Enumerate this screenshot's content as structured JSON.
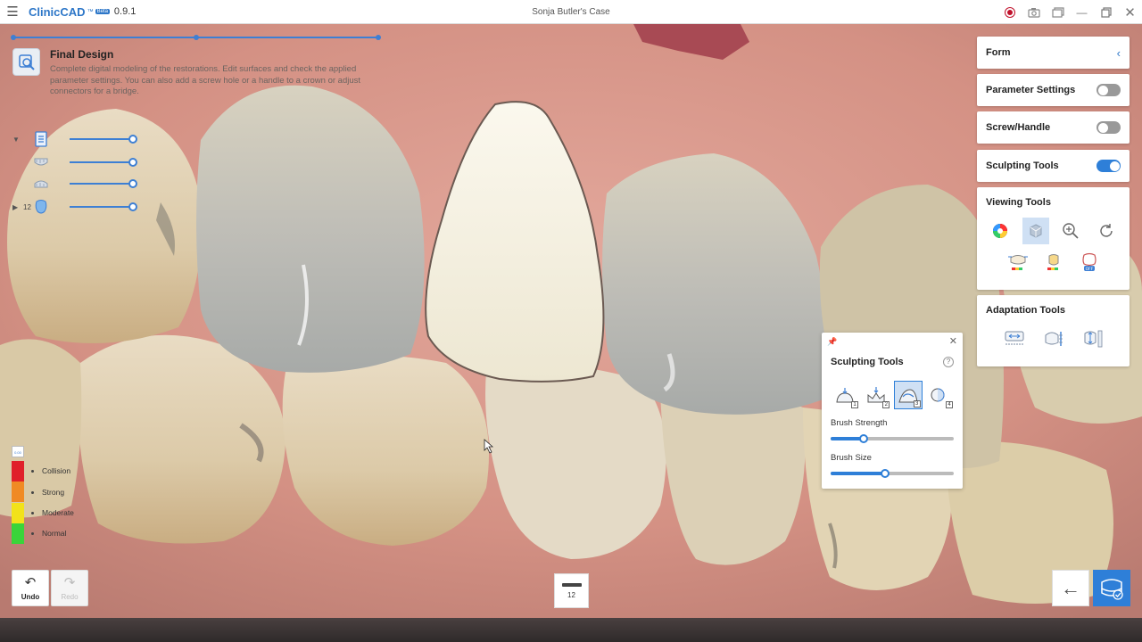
{
  "titlebar": {
    "brand": "ClinicCAD",
    "brand_sup": "™",
    "beta": "Beta",
    "version": "0.9.1",
    "case_name": "Sonja Butler's Case"
  },
  "step": {
    "title": "Final Design",
    "description": "Complete digital modeling of the restorations. Edit surfaces and check the applied parameter settings. You can also add a screw hole or a handle to a crown or adjust connectors for a bridge.",
    "progress_fraction": 1.0
  },
  "objects": [
    {
      "icon": "document-icon",
      "opacity": 1.0
    },
    {
      "icon": "upper-jaw-icon",
      "opacity": 1.0
    },
    {
      "icon": "lower-jaw-icon",
      "opacity": 1.0
    },
    {
      "icon": "tooth-icon",
      "tooth_number": "12",
      "opacity": 1.0
    }
  ],
  "legend": {
    "head_value": "0.00",
    "items": [
      {
        "label": "Collision",
        "color": "#e0202a"
      },
      {
        "label": "Strong",
        "color": "#f08a24"
      },
      {
        "label": "Moderate",
        "color": "#f2e21a"
      },
      {
        "label": "Normal",
        "color": "#3ad43a"
      }
    ]
  },
  "bottom": {
    "undo_label": "Undo",
    "redo_label": "Redo",
    "tooth_number": "12"
  },
  "panel": {
    "form_title": "Form",
    "parameter_settings": {
      "label": "Parameter Settings",
      "on": false
    },
    "screw_handle": {
      "label": "Screw/Handle",
      "on": false
    },
    "sculpting_tools": {
      "label": "Sculpting Tools",
      "on": true
    },
    "viewing_tools_title": "Viewing Tools",
    "adaptation_tools_title": "Adaptation Tools"
  },
  "sculpt_popup": {
    "title": "Sculpting Tools",
    "help": "?",
    "brushes": [
      "1",
      "2",
      "3",
      "4"
    ],
    "active_brush": 3,
    "brush_strength_label": "Brush Strength",
    "brush_strength": 0.27,
    "brush_size_label": "Brush Size",
    "brush_size": 0.44
  },
  "colors": {
    "accent": "#2e7fd8",
    "brand": "#2e77c8",
    "crown": "#f4f0e2"
  }
}
